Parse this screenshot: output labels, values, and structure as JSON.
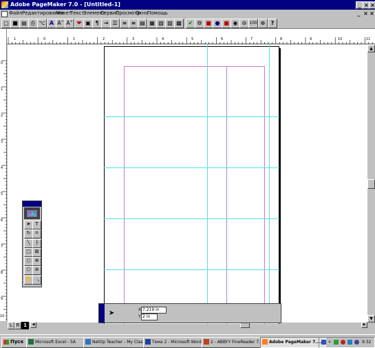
{
  "app": {
    "title": "Adobe PageMaker 7.0 - [Untitled-1]",
    "window_buttons": [
      "_",
      "×",
      "×"
    ]
  },
  "menu": {
    "items": [
      "Файл",
      "Редактирование",
      "Макет",
      "Текст",
      "Элемент",
      "Сервис",
      "Просмотр",
      "Окно",
      "Помощь"
    ]
  },
  "toolbar": {
    "glyphs": [
      "□",
      "■",
      "▤",
      "⎙",
      "⌥",
      "A",
      "A˄",
      "A˅",
      "❤",
      "▣",
      "¶",
      "⇥",
      "☰",
      "≡",
      "≡",
      "▤",
      "▦",
      "▧",
      "▨",
      "▩",
      "✔",
      "⚙",
      "■",
      "●",
      "■",
      "◉",
      "⊖",
      "100",
      "⊕",
      "?"
    ]
  },
  "rulers": {
    "h_numbers": [
      "1",
      "0",
      "1",
      "2",
      "3",
      "4",
      "5",
      "6",
      "7",
      "8",
      "9",
      "10",
      "11",
      "12"
    ],
    "v_numbers": [
      "0",
      "1",
      "2",
      "3",
      "4",
      "5",
      "6",
      "7",
      "8",
      "9",
      "10"
    ]
  },
  "controls": {
    "x_label": "X",
    "x_value": "7.219 in",
    "y_label": "Y",
    "y_value": "2 in"
  },
  "page_tabs": {
    "labels": [
      "L",
      "R",
      "1"
    ]
  },
  "taskbar": {
    "start": "Пуск",
    "tasks": [
      "Microsoft Excel - 5A",
      "NetOp Teacher - My Class",
      "Тема 2 - Microsoft Word",
      "2 - ABBYY FineReader 7....",
      "Adobe PageMaker 7...."
    ],
    "time": "9:32"
  },
  "colors": {
    "title_blue": "#000080",
    "margin_guide": "#d070d0",
    "ruler_guide": "#55dde8"
  }
}
